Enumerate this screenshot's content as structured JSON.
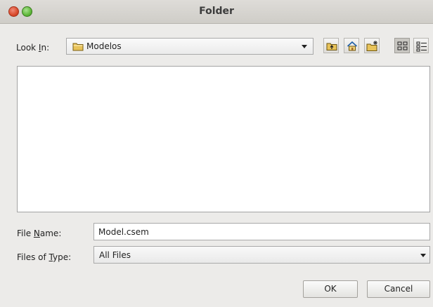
{
  "window": {
    "title": "Folder"
  },
  "look_in": {
    "label_prefix": "Look ",
    "label_mnemonic": "I",
    "label_suffix": "n:",
    "value": "Modelos"
  },
  "toolbar": {
    "icons": [
      "up-one-level-icon",
      "home-icon",
      "new-folder-icon",
      "list-view-icon",
      "details-view-icon"
    ]
  },
  "file_name": {
    "label_prefix": "File ",
    "label_mnemonic": "N",
    "label_suffix": "ame:",
    "value": "Model.csem"
  },
  "file_type": {
    "label_prefix": "Files of ",
    "label_mnemonic": "T",
    "label_suffix": "ype:",
    "value": "All Files"
  },
  "buttons": {
    "ok": "OK",
    "cancel": "Cancel"
  },
  "colors": {
    "close": "#d94a2b",
    "maximize": "#5fb83a",
    "folder": "#e8c35a"
  }
}
